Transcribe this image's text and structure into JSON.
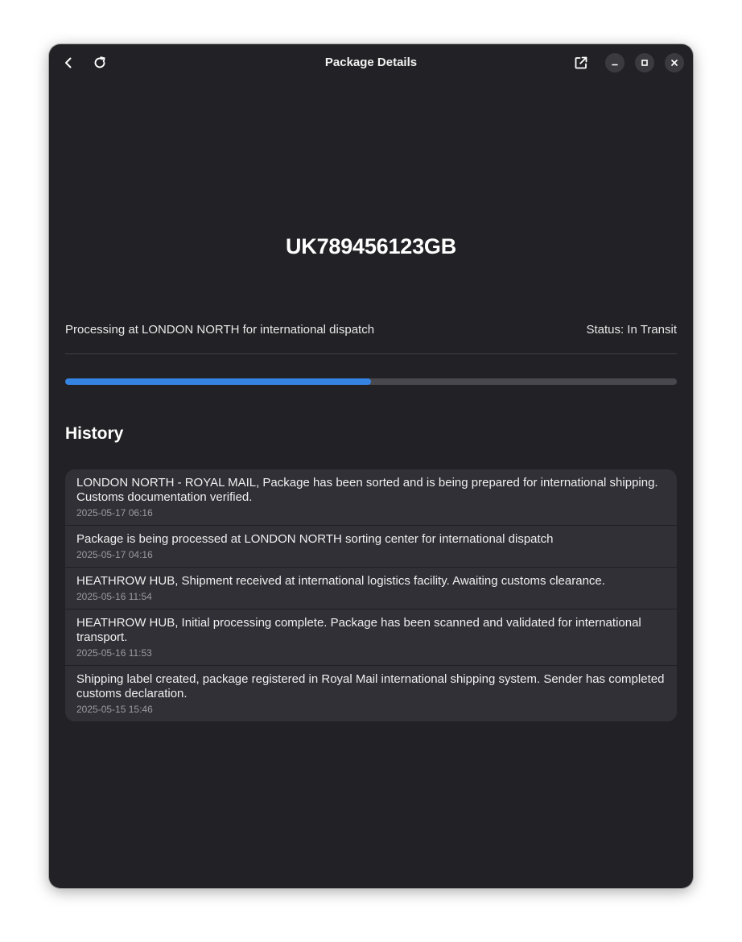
{
  "window": {
    "title": "Package Details"
  },
  "headerbar": {
    "back_icon": "go-back-icon",
    "reload_icon": "reload-icon",
    "open_external_icon": "open-external-icon",
    "minimize_icon": "minimize-icon",
    "maximize_icon": "maximize-icon",
    "close_icon": "close-icon"
  },
  "package": {
    "tracking_number": "UK789456123GB",
    "status_description": "Processing at LONDON NORTH for international dispatch",
    "status": "Status: In Transit",
    "progress": 0.5
  },
  "history": {
    "heading": "History",
    "items": [
      {
        "text": "LONDON NORTH - ROYAL MAIL, Package has been sorted and is being prepared for international shipping. Customs documentation verified.",
        "time": "2025-05-17 06:16"
      },
      {
        "text": "Package is being processed at LONDON NORTH sorting center for international dispatch",
        "time": "2025-05-17 04:16"
      },
      {
        "text": "HEATHROW HUB, Shipment received at international logistics facility. Awaiting customs clearance.",
        "time": "2025-05-16 11:54"
      },
      {
        "text": "HEATHROW HUB, Initial processing complete. Package has been scanned and validated for international transport.",
        "time": "2025-05-16 11:53"
      },
      {
        "text": "Shipping label created, package registered in Royal Mail international shipping system. Sender has completed customs declaration.",
        "time": "2025-05-15 15:46"
      }
    ]
  },
  "colors": {
    "window_bg": "#222226",
    "card_bg": "#303036",
    "accent": "#3584e4",
    "progress_track": "#48484e"
  }
}
